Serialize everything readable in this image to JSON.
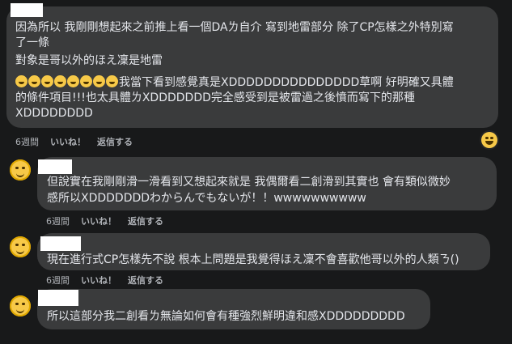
{
  "comments": [
    {
      "lines": [
        "因為所以 我剛剛想起來之前推上看一個DAㄌ自介 寫到地雷部分 除了CP怎樣之外特別寫",
        "了一條",
        "對象是哥以外的ほえ凜是地雷"
      ],
      "emoji_line_text": "我當下看到感覺真是XDDDDDDDDDDDDDDD草啊 好明確又具體",
      "extra_lines": [
        "的條件項目!!!也太具體ㄌXDDDDDDD完全感受到是被雷過之後憤而寫下的那種",
        "XDDDDDDDD"
      ],
      "time": "6週間",
      "like": "いいね！",
      "reply": "返信する"
    },
    {
      "lines": [
        "但說實在我剛剛滑一滑看到又想起來就是 我偶爾看二創滑到其實也 會有類似微妙",
        "感所以XDDDDDDDわからんでもないが！！wwwwwwwwww"
      ],
      "time": "6週間",
      "like": "いいね！",
      "reply": "返信する"
    },
    {
      "lines": [
        "現在進行式CP怎樣先不說 根本上問題是我覺得ほえ凜不會喜歡他哥以外的人類ㄋ()"
      ],
      "time": "6週間",
      "like": "いいね！",
      "reply": "返信する"
    },
    {
      "lines": [
        "所以這部分我二創看ㄌ無論如何會有種強烈鮮明違和感XDDDDDDDDD"
      ]
    }
  ]
}
